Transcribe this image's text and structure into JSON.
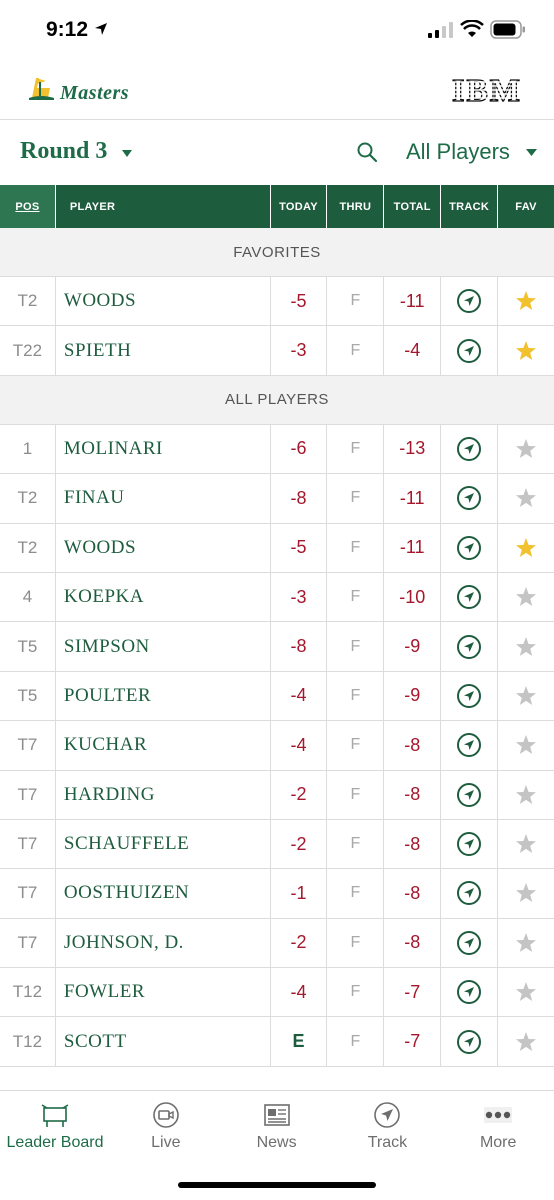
{
  "status": {
    "time": "9:12"
  },
  "brand": {
    "app_name": "Masters",
    "sponsor": "IBM"
  },
  "controls": {
    "round": "Round 3",
    "filter": "All Players"
  },
  "table_header": {
    "pos": "POS",
    "player": "PLAYER",
    "today": "TODAY",
    "thru": "THRU",
    "total": "TOTAL",
    "track": "TRACK",
    "fav": "FAV"
  },
  "sections": {
    "favorites": "FAVORITES",
    "all_players": "ALL PLAYERS"
  },
  "favorites": [
    {
      "pos": "T2",
      "player": "WOODS",
      "today": "-5",
      "thru": "F",
      "total": "-11",
      "fav": true
    },
    {
      "pos": "T22",
      "player": "SPIETH",
      "today": "-3",
      "thru": "F",
      "total": "-4",
      "fav": true
    }
  ],
  "players": [
    {
      "pos": "1",
      "player": "MOLINARI",
      "today": "-6",
      "thru": "F",
      "total": "-13",
      "fav": false
    },
    {
      "pos": "T2",
      "player": "FINAU",
      "today": "-8",
      "thru": "F",
      "total": "-11",
      "fav": false
    },
    {
      "pos": "T2",
      "player": "WOODS",
      "today": "-5",
      "thru": "F",
      "total": "-11",
      "fav": true
    },
    {
      "pos": "4",
      "player": "KOEPKA",
      "today": "-3",
      "thru": "F",
      "total": "-10",
      "fav": false
    },
    {
      "pos": "T5",
      "player": "SIMPSON",
      "today": "-8",
      "thru": "F",
      "total": "-9",
      "fav": false
    },
    {
      "pos": "T5",
      "player": "POULTER",
      "today": "-4",
      "thru": "F",
      "total": "-9",
      "fav": false
    },
    {
      "pos": "T7",
      "player": "KUCHAR",
      "today": "-4",
      "thru": "F",
      "total": "-8",
      "fav": false
    },
    {
      "pos": "T7",
      "player": "HARDING",
      "today": "-2",
      "thru": "F",
      "total": "-8",
      "fav": false
    },
    {
      "pos": "T7",
      "player": "SCHAUFFELE",
      "today": "-2",
      "thru": "F",
      "total": "-8",
      "fav": false
    },
    {
      "pos": "T7",
      "player": "OOSTHUIZEN",
      "today": "-1",
      "thru": "F",
      "total": "-8",
      "fav": false
    },
    {
      "pos": "T7",
      "player": "JOHNSON, D.",
      "today": "-2",
      "thru": "F",
      "total": "-8",
      "fav": false
    },
    {
      "pos": "T12",
      "player": "FOWLER",
      "today": "-4",
      "thru": "F",
      "total": "-7",
      "fav": false
    },
    {
      "pos": "T12",
      "player": "SCOTT",
      "today": "E",
      "thru": "F",
      "total": "-7",
      "fav": false
    }
  ],
  "tabs": [
    {
      "label": "Leader Board",
      "icon": "leaderboard-icon",
      "active": true
    },
    {
      "label": "Live",
      "icon": "video-camera-icon",
      "active": false
    },
    {
      "label": "News",
      "icon": "newspaper-icon",
      "active": false
    },
    {
      "label": "Track",
      "icon": "track-arrow-icon",
      "active": false
    },
    {
      "label": "More",
      "icon": "more-dots-icon",
      "active": false
    }
  ],
  "colors": {
    "brand_green": "#1e6b48",
    "header_green": "#1e5c3e",
    "score_red": "#a4172c",
    "fav_gold": "#f2c12e",
    "star_gray": "#c4c4c4"
  }
}
